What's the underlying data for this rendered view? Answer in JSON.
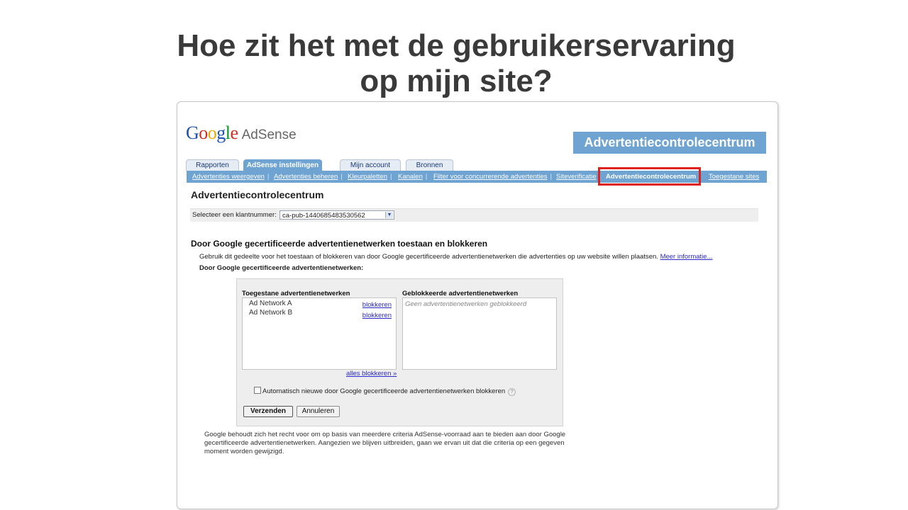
{
  "slide": {
    "title_line1": "Hoe zit het met de gebruikerservaring",
    "title_line2": "op mijn site?"
  },
  "logo": {
    "letters": [
      "G",
      "o",
      "o",
      "g",
      "l",
      "e"
    ],
    "product": "AdSense"
  },
  "callout": {
    "label": "Advertentiecontrolecentrum"
  },
  "tabs": [
    {
      "label": "Rapporten",
      "active": false
    },
    {
      "label": "AdSense instellingen",
      "active": true
    },
    {
      "label": "Mijn account",
      "active": false
    },
    {
      "label": "Bronnen",
      "active": false
    }
  ],
  "subnav": [
    {
      "label": "Advertenties weergeven"
    },
    {
      "label": "Advertenties beheren"
    },
    {
      "label": "Kleurpaletten"
    },
    {
      "label": "Kanalen"
    },
    {
      "label": "Filter voor concurrerende advertenties"
    },
    {
      "label": "Siteverificatie"
    },
    {
      "label": "Advertentiecontrolecentrum",
      "current": true
    },
    {
      "label": "Toegestane sites"
    }
  ],
  "page": {
    "heading": "Advertentiecontrolecentrum",
    "client_label": "Selecteer een klantnummer:",
    "client_value": "ca-pub-1440685483530562",
    "section_heading": "Door Google gecertificeerde advertentienetwerken toestaan en blokkeren",
    "description": "Gebruik dit gedeelte voor het toestaan of blokkeren van door Google gecertificeerde advertentienetwerken die advertenties op uw website willen plaatsen.",
    "more_info": "Meer informatie...",
    "subheading": "Door Google gecertificeerde advertentienetwerken:"
  },
  "panel": {
    "allowed_head": "Toegestane advertentienetwerken",
    "blocked_head": "Geblokkeerde advertentienetwerken",
    "allowed": [
      {
        "name": "Ad Network A",
        "action": "blokkeren"
      },
      {
        "name": "Ad Network B",
        "action": "blokkeren"
      }
    ],
    "blocked_empty": "Geen advertentienetwerken geblokkeerd",
    "block_all": "alles blokkeren »",
    "auto_block_label": "Automatisch nieuwe door Google gecertificeerde advertentienetwerken blokkeren",
    "help_symbol": "?",
    "submit": "Verzenden",
    "cancel": "Annuleren"
  },
  "footnote": "Google behoudt zich het recht voor om op basis van meerdere criteria AdSense-voorraad aan te bieden aan door Google gecertificeerde advertentienetwerken. Aangezien we blijven uitbreiden, gaan we ervan uit dat die criteria op een gegeven moment worden gewijzigd.",
  "colors": {
    "accent_blue": "#6fa3d1",
    "highlight_red": "#e0201b",
    "link_blue": "#2a2acc",
    "title_gray": "#3a3a3a"
  }
}
